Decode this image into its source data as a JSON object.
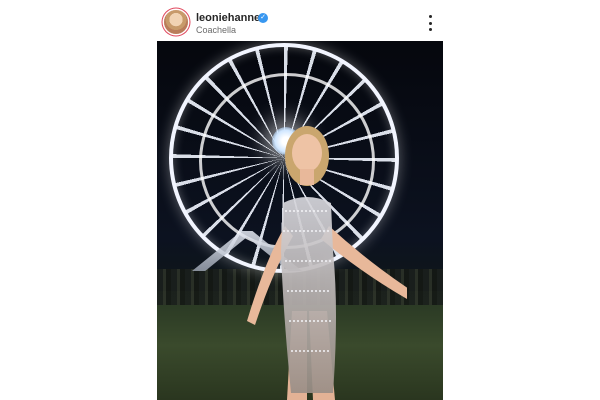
{
  "post": {
    "username": "leoniehanne",
    "location": "Coachella"
  },
  "icons": {
    "verified": "verified-badge-icon",
    "more": "more-options-icon"
  },
  "colors": {
    "verified_blue": "#3897f0",
    "story_ring": "#e0475d"
  }
}
